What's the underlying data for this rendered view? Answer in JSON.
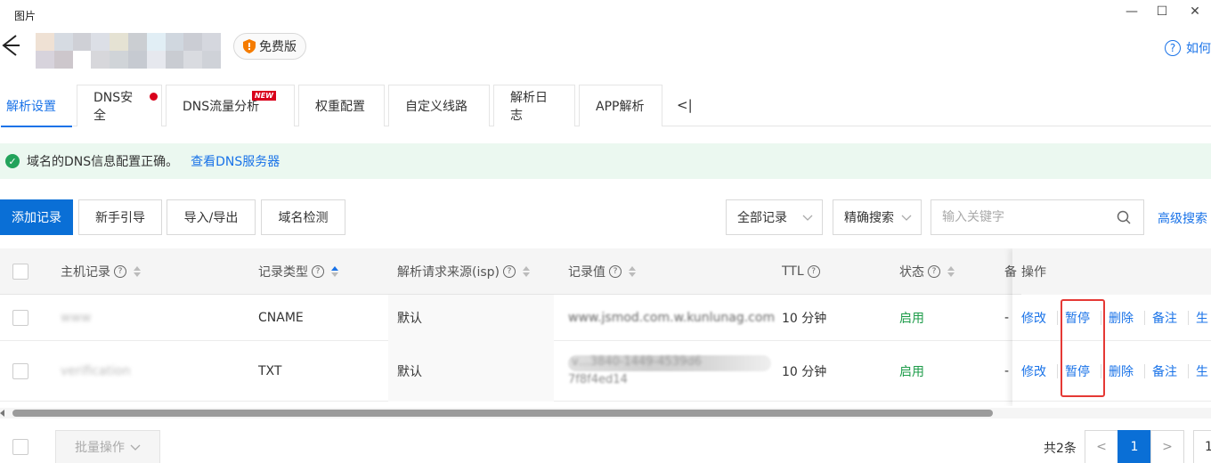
{
  "window": {
    "title": "图片",
    "controls": [
      "—",
      "☐",
      "✕"
    ]
  },
  "header": {
    "plan_badge": "免费版",
    "help_link": "如何"
  },
  "tabs": [
    {
      "label": "解析设置",
      "active": true
    },
    {
      "label": "DNS安全",
      "dot": true
    },
    {
      "label": "DNS流量分析",
      "badge": "NEW"
    },
    {
      "label": "权重配置"
    },
    {
      "label": "自定义线路"
    },
    {
      "label": "解析日志"
    },
    {
      "label": "APP解析"
    }
  ],
  "tabs_collapse": "<|",
  "banner": {
    "message": "域名的DNS信息配置正确。",
    "link": "查看DNS服务器"
  },
  "toolbar": {
    "add_record": "添加记录",
    "guide": "新手引导",
    "import_export": "导入/导出",
    "domain_check": "域名检测",
    "filter_all": "全部记录",
    "search_mode": "精确搜索",
    "search_placeholder": "输入关键字",
    "advanced_search": "高级搜索"
  },
  "table": {
    "headers": {
      "host": "主机记录",
      "type": "记录类型",
      "isp": "解析请求来源(isp)",
      "value": "记录值",
      "ttl": "TTL",
      "status": "状态",
      "remark": "备",
      "actions": "操作"
    },
    "rows": [
      {
        "host": "www",
        "type": "CNAME",
        "isp": "默认",
        "value": "www.jsmod.com.w.kunlunag.com",
        "ttl": "10 分钟",
        "status": "启用",
        "remark": "-"
      },
      {
        "host": "verification",
        "type": "TXT",
        "isp": "默认",
        "value": "v…3840-1449-4539d6",
        "value2": "7f8f4ed14",
        "ttl": "10 分钟",
        "status": "启用",
        "remark": "-"
      }
    ],
    "actions": [
      "修改",
      "暂停",
      "删除",
      "备注",
      "生"
    ]
  },
  "footer": {
    "batch": "批量操作",
    "total": "共2条",
    "prev": "<",
    "current_page": "1",
    "next": ">",
    "page_size": "1"
  },
  "colors": {
    "accent": "#1a73e8",
    "primary_button": "#0a6fd6",
    "success": "#1e9c4a",
    "banner_bg": "#ebf8f0",
    "highlight": "#e53935"
  }
}
